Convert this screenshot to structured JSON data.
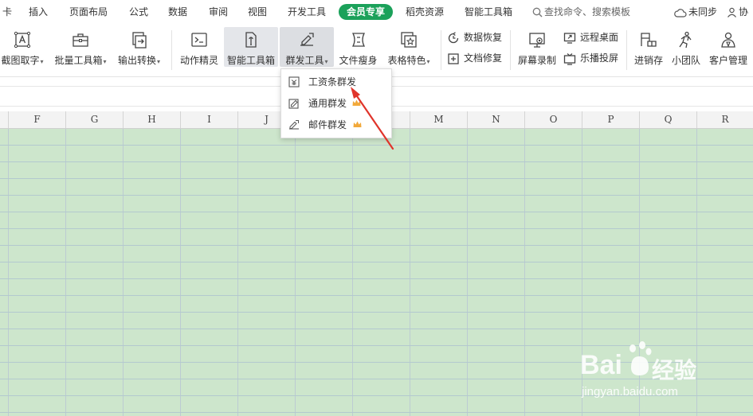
{
  "menubar": {
    "tabs": [
      "卡",
      "插入",
      "页面布局",
      "公式",
      "数据",
      "审阅",
      "视图",
      "开发工具",
      "会员专享",
      "稻壳资源",
      "智能工具箱"
    ],
    "active_tab": "会员专享",
    "search_placeholder": "查找命令、搜索模板",
    "sync_label": "未同步",
    "collab_label": "协"
  },
  "ribbon": {
    "buttons": [
      {
        "label": "截图取字",
        "icon": "screenshot-text-icon",
        "dropdown": true
      },
      {
        "label": "批量工具箱",
        "icon": "toolbox-icon",
        "dropdown": true
      },
      {
        "label": "输出转换",
        "icon": "output-convert-icon",
        "dropdown": true
      },
      {
        "label": "动作精灵",
        "icon": "action-script-icon",
        "dropdown": false
      },
      {
        "label": "智能工具箱",
        "icon": "smart-toolbox-icon",
        "dropdown": false
      },
      {
        "label": "群发工具",
        "icon": "mass-send-icon",
        "dropdown": true
      },
      {
        "label": "文件瘦身",
        "icon": "file-slim-icon",
        "dropdown": false
      },
      {
        "label": "表格特色",
        "icon": "table-feature-icon",
        "dropdown": true
      }
    ],
    "small_buttons": [
      {
        "label": "数据恢复",
        "icon": "data-recovery-icon"
      },
      {
        "label": "文档修复",
        "icon": "doc-repair-icon"
      },
      {
        "label": "远程桌面",
        "icon": "remote-desktop-icon"
      },
      {
        "label": "乐播投屏",
        "icon": "cast-screen-icon"
      }
    ],
    "right_buttons": [
      {
        "label": "屏幕录制",
        "icon": "screen-record-icon"
      },
      {
        "label": "进销存",
        "icon": "inventory-icon"
      },
      {
        "label": "小团队",
        "icon": "team-icon"
      },
      {
        "label": "客户管理",
        "icon": "customer-icon"
      }
    ]
  },
  "columns": [
    "F",
    "G",
    "H",
    "I",
    "J",
    "K",
    "L",
    "M",
    "N",
    "O",
    "P",
    "Q",
    "R"
  ],
  "dropdown": {
    "items": [
      {
        "label": "工资条群发",
        "icon": "payslip-icon",
        "vip": false
      },
      {
        "label": "通用群发",
        "icon": "general-send-icon",
        "vip": true
      },
      {
        "label": "邮件群发",
        "icon": "email-send-icon",
        "vip": true
      }
    ]
  },
  "watermark": {
    "brand": "Bai",
    "brand2": "经验",
    "url": "jingyan.baidu.com"
  },
  "colors": {
    "accent": "#1ba15a",
    "grid_bg": "#cde6cc",
    "arrow": "#e0342b",
    "crown": "#f2a93b"
  }
}
